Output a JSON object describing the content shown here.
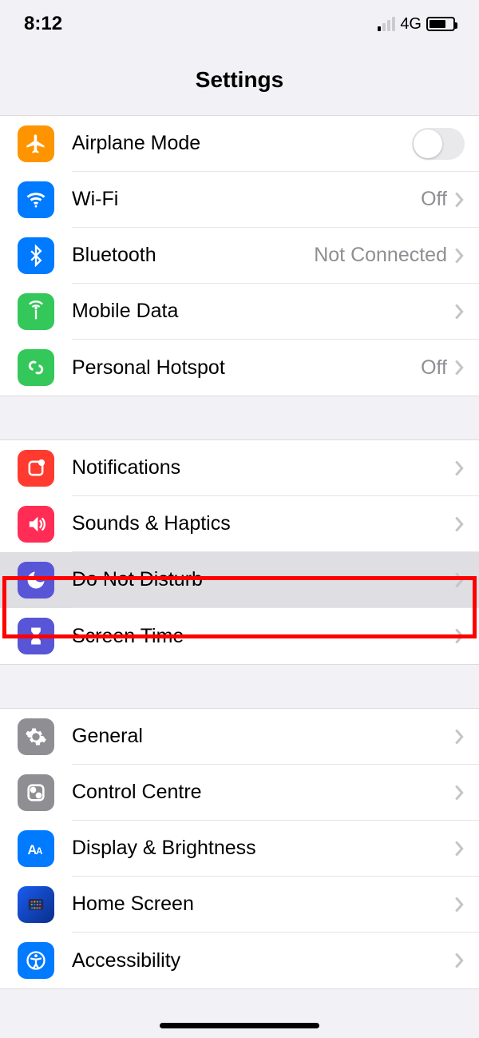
{
  "status_bar": {
    "time": "8:12",
    "network": "4G"
  },
  "header": {
    "title": "Settings"
  },
  "sections": [
    {
      "rows": [
        {
          "id": "airplane-mode",
          "label": "Airplane Mode",
          "status": "",
          "toggle": true
        },
        {
          "id": "wifi",
          "label": "Wi-Fi",
          "status": "Off"
        },
        {
          "id": "bluetooth",
          "label": "Bluetooth",
          "status": "Not Connected"
        },
        {
          "id": "mobile-data",
          "label": "Mobile Data",
          "status": ""
        },
        {
          "id": "personal-hotspot",
          "label": "Personal Hotspot",
          "status": "Off"
        }
      ]
    },
    {
      "rows": [
        {
          "id": "notifications",
          "label": "Notifications",
          "status": ""
        },
        {
          "id": "sounds-haptics",
          "label": "Sounds & Haptics",
          "status": ""
        },
        {
          "id": "do-not-disturb",
          "label": "Do Not Disturb",
          "status": "",
          "selected": true
        },
        {
          "id": "screen-time",
          "label": "Screen Time",
          "status": ""
        }
      ]
    },
    {
      "rows": [
        {
          "id": "general",
          "label": "General",
          "status": ""
        },
        {
          "id": "control-centre",
          "label": "Control Centre",
          "status": ""
        },
        {
          "id": "display-brightness",
          "label": "Display & Brightness",
          "status": ""
        },
        {
          "id": "home-screen",
          "label": "Home Screen",
          "status": ""
        },
        {
          "id": "accessibility",
          "label": "Accessibility",
          "status": ""
        }
      ]
    }
  ]
}
